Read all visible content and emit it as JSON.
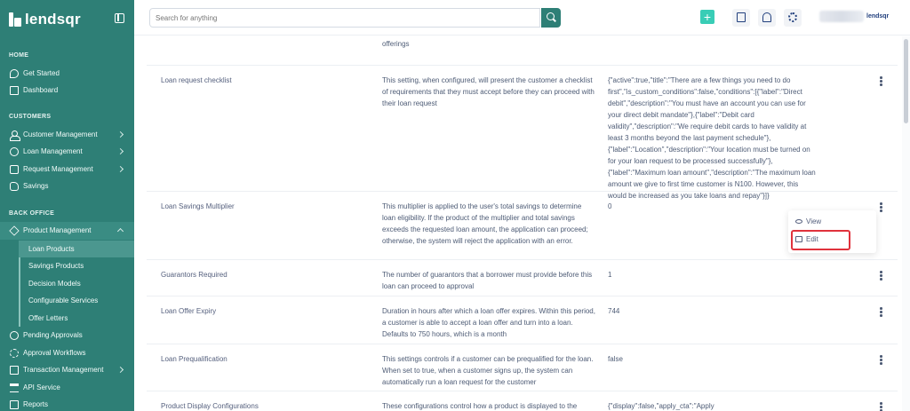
{
  "sidebar": {
    "brand": "lendsqr",
    "sections": {
      "home": "HOME",
      "customers": "CUSTOMERS",
      "back_office": "BACK OFFICE"
    },
    "items": {
      "get_started": "Get Started",
      "dashboard": "Dashboard",
      "customer_management": "Customer Management",
      "loan_management": "Loan Management",
      "request_management": "Request Management",
      "savings": "Savings",
      "product_management": "Product Management",
      "loan_products": "Loan Products",
      "savings_products": "Savings Products",
      "decision_models": "Decision Models",
      "configurable_services": "Configurable Services",
      "offer_letters": "Offer Letters",
      "pending_approvals": "Pending Approvals",
      "approval_workflows": "Approval Workflows",
      "transaction_management": "Transaction Management",
      "api_service": "API Service",
      "reports": "Reports"
    }
  },
  "topbar": {
    "search_placeholder": "Search for anything",
    "plus": "+",
    "org_brand": "lendsqr"
  },
  "rows": [
    {
      "name": "",
      "description": "offerings which are a lender to create different loan offerings for different customers types to allow customers apply for any specific offerings",
      "value": ""
    },
    {
      "name": "Loan request checklist",
      "description": "This setting, when configured, will present the customer a checklist of requirements that they must accept before they can proceed with their loan request",
      "value": "{\"active\":true,\"title\":\"There are a few things you need to do first\",\"is_custom_conditions\":false,\"conditions\":[{\"label\":\"Direct debit\",\"description\":\"You must have an account you can use for your direct debit mandate\"},{\"label\":\"Debit card validity\",\"description\":\"We require debit cards to have validity at least 3 months beyond the last payment schedule\"},{\"label\":\"Location\",\"description\":\"Your location must be turned on for your loan request to be processed successfully\"},{\"label\":\"Maximum loan amount\",\"description\":\"The maximum loan amount we give to first time customer is N100. However, this would be increased as you take loans and repay\"}]}"
    },
    {
      "name": "Loan Savings Multiplier",
      "description": "This multiplier is applied to the user's total savings to determine loan eligibility. If the product of the multiplier and total savings exceeds the requested loan amount, the application can proceed; otherwise, the system will reject the application with an error.",
      "value": "0"
    },
    {
      "name": "Guarantors Required",
      "description": "The number of guarantors that a borrower must provide before this loan can proceed to approval",
      "value": "1"
    },
    {
      "name": "Loan Offer Expiry",
      "description": "Duration in hours after which a loan offer expires. Within this period, a customer is able to accept a loan offer and turn into a loan. Defaults to 750 hours, which is a month",
      "value": "744"
    },
    {
      "name": "Loan Prequalification",
      "description": "This settings controls if a customer can be prequalified for the loan. When set to true, when a customer signs up, the system can automatically run a loan request for the customer",
      "value": "false"
    },
    {
      "name": "Product Display Configurations",
      "description": "These configurations control how a product is displayed to the",
      "value": "{\"display\":false,\"apply_cta\":\"Apply"
    }
  ],
  "menu": {
    "view": "View",
    "edit": "Edit"
  },
  "colors": {
    "sidebar": "#2e7f76",
    "accent": "#39cdb6",
    "highlight": "#e0323c"
  }
}
